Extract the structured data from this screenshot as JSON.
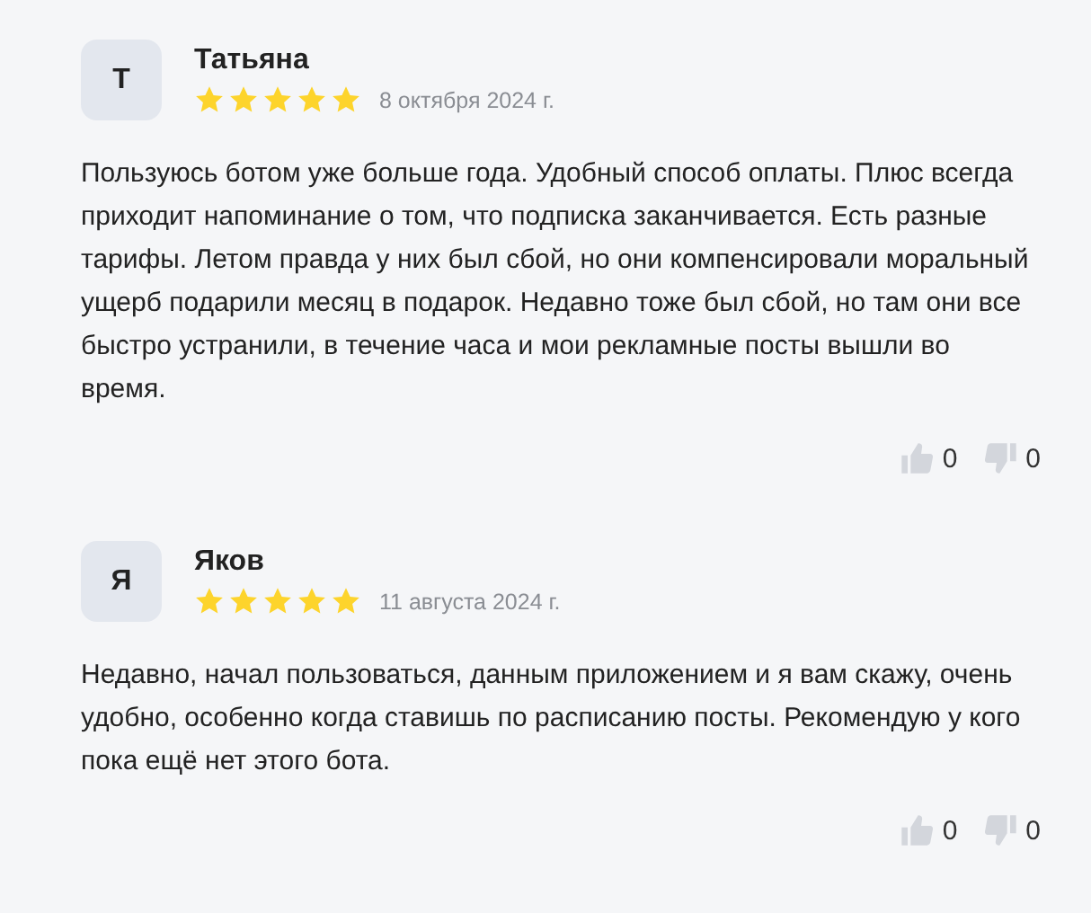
{
  "reviews": [
    {
      "avatar": "Т",
      "name": "Татьяна",
      "stars": 5,
      "date": "8 октября 2024 г.",
      "text": "Пользуюсь ботом уже больше года. Удобный способ оплаты. Плюс всегда приходит напоминание о том, что подписка заканчивается. Есть разные тарифы. Летом правда у них был сбой, но они компенсировали моральный ущерб подарили месяц в подарок. Недавно тоже был сбой, но там они все быстро устранили, в течение часа и мои рекламные посты вышли во время.",
      "likes": "0",
      "dislikes": "0"
    },
    {
      "avatar": "Я",
      "name": "Яков",
      "stars": 5,
      "date": "11 августа 2024 г.",
      "text": "Недавно, начал пользоваться, данным приложением и я вам скажу, очень удобно, особенно когда ставишь по расписанию посты. Рекомендую у кого пока ещё нет этого бота.",
      "likes": "0",
      "dislikes": "0"
    }
  ]
}
